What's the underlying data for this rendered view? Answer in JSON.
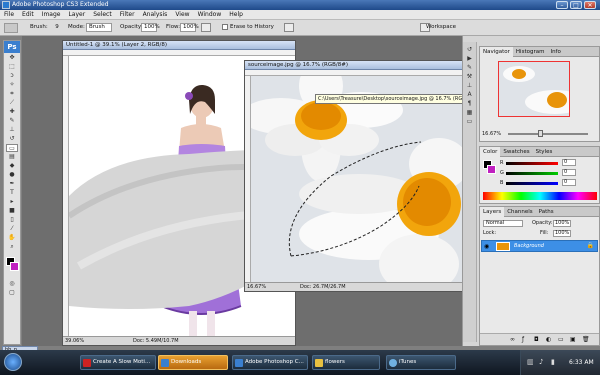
{
  "app": {
    "title": "Adobe Photoshop CS3 Extended",
    "min": "–",
    "max": "□",
    "close": "✕"
  },
  "menu": [
    "File",
    "Edit",
    "Image",
    "Layer",
    "Select",
    "Filter",
    "Analysis",
    "View",
    "Window",
    "Help"
  ],
  "options": {
    "brush_label": "Brush:",
    "brush_size": "9",
    "mode_label": "Mode:",
    "mode_value": "Brush",
    "opacity_label": "Opacity:",
    "opacity_value": "100%",
    "flow_label": "Flow:",
    "flow_value": "100%",
    "erase_history_label": "Erase to History",
    "workspace_label": "Workspace"
  },
  "doc1": {
    "title": "Untitled-1 @ 39.1% (Layer 2, RGB/8)",
    "zoom": "39.06%",
    "docsize": "Doc: 5.49M/10.7M"
  },
  "doc2": {
    "title": "sourceimage.jpg @ 16.7% (RGB/8#)",
    "tooltip": "C:\\Users\\Treasure\\Desktop\\sourceimage.jpg @ 16.7% (RGB/8#)",
    "zoom": "16.67%",
    "docsize": "Doc: 26.7M/26.7M"
  },
  "navigator": {
    "tabs": [
      "Navigator",
      "Histogram",
      "Info"
    ],
    "zoom": "16.67%"
  },
  "color": {
    "tabs": [
      "Color",
      "Swatches",
      "Styles"
    ],
    "r_label": "R",
    "g_label": "G",
    "b_label": "B",
    "r": "0",
    "g": "0",
    "b": "0"
  },
  "layers": {
    "tabs": [
      "Layers",
      "Channels",
      "Paths"
    ],
    "blend_mode": "Normal",
    "opacity_label": "Opacity:",
    "opacity": "100%",
    "lock_label": "Lock:",
    "fill_label": "Fill:",
    "fill": "100%",
    "layer_name": "Background"
  },
  "taskbar": {
    "minimized_doc": "bb_p...",
    "items": [
      "Create A Slow Moti...",
      "Downloads",
      "Adobe Photoshop C...",
      "flowers",
      "iTunes"
    ],
    "clock": "6:33 AM"
  },
  "colors": {
    "accent": "#3a7fcf",
    "layer_selected": "#3d8fe6",
    "dress": "#a070d8"
  }
}
